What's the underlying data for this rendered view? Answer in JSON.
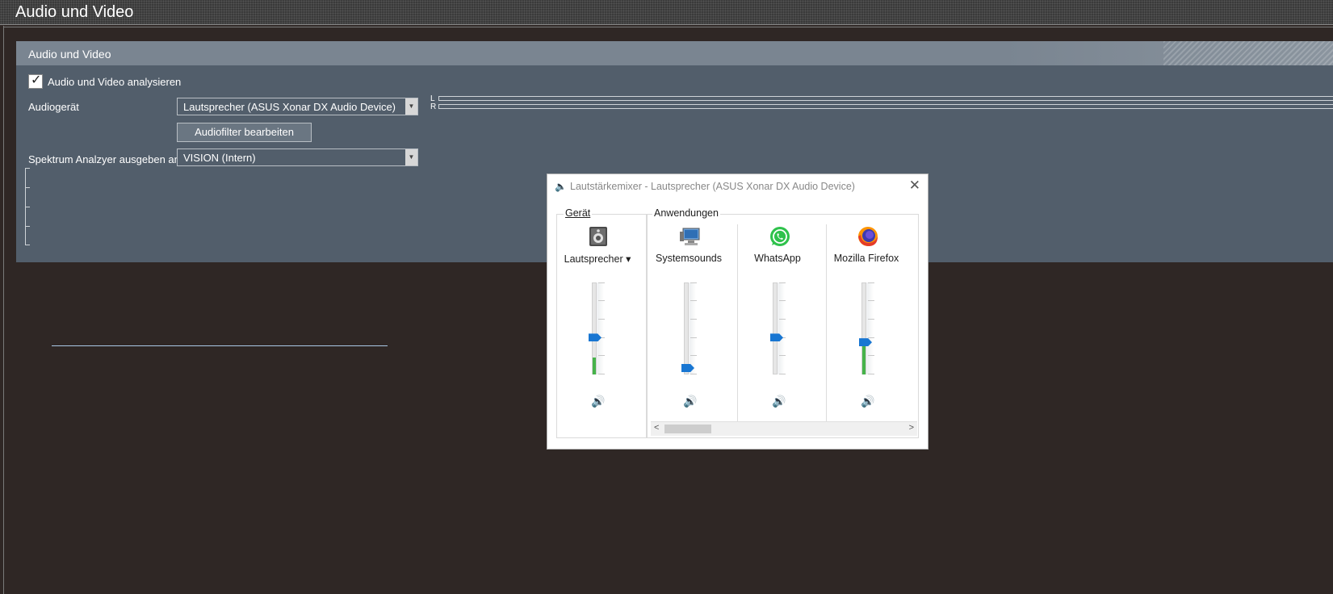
{
  "window": {
    "title": "Audio und Video"
  },
  "panel": {
    "header": "Audio und Video",
    "analyze_checkbox": {
      "label": "Audio und Video analysieren",
      "checked": true
    },
    "audio_device": {
      "label": "Audiogerät",
      "value": "Lautsprecher (ASUS Xonar DX Audio Device)"
    },
    "filter_button": "Audiofilter bearbeiten",
    "spectrum": {
      "label": "Spektrum Analzyer ausgeben an",
      "value": "VISION (Intern)"
    },
    "meter_labels": {
      "left": "L",
      "right": "R"
    }
  },
  "mixer": {
    "title": "Lautstärkemixer - Lautsprecher (ASUS Xonar DX Audio Device)",
    "device_group": "Gerät",
    "apps_group": "Anwendungen",
    "device": {
      "name": "Lautsprecher ▾",
      "icon": "speaker-device-icon",
      "volume": 0.4,
      "level": 0.18
    },
    "apps": [
      {
        "name": "Systemsounds",
        "icon": "system-sounds-icon",
        "volume": 0.07,
        "level": 0.0
      },
      {
        "name": "WhatsApp",
        "icon": "whatsapp-icon",
        "volume": 0.4,
        "level": 0.0
      },
      {
        "name": "Mozilla Firefox",
        "icon": "firefox-icon",
        "volume": 0.35,
        "level": 0.35
      }
    ],
    "colors": {
      "accent": "#1876d2",
      "level": "#46b34a"
    }
  }
}
